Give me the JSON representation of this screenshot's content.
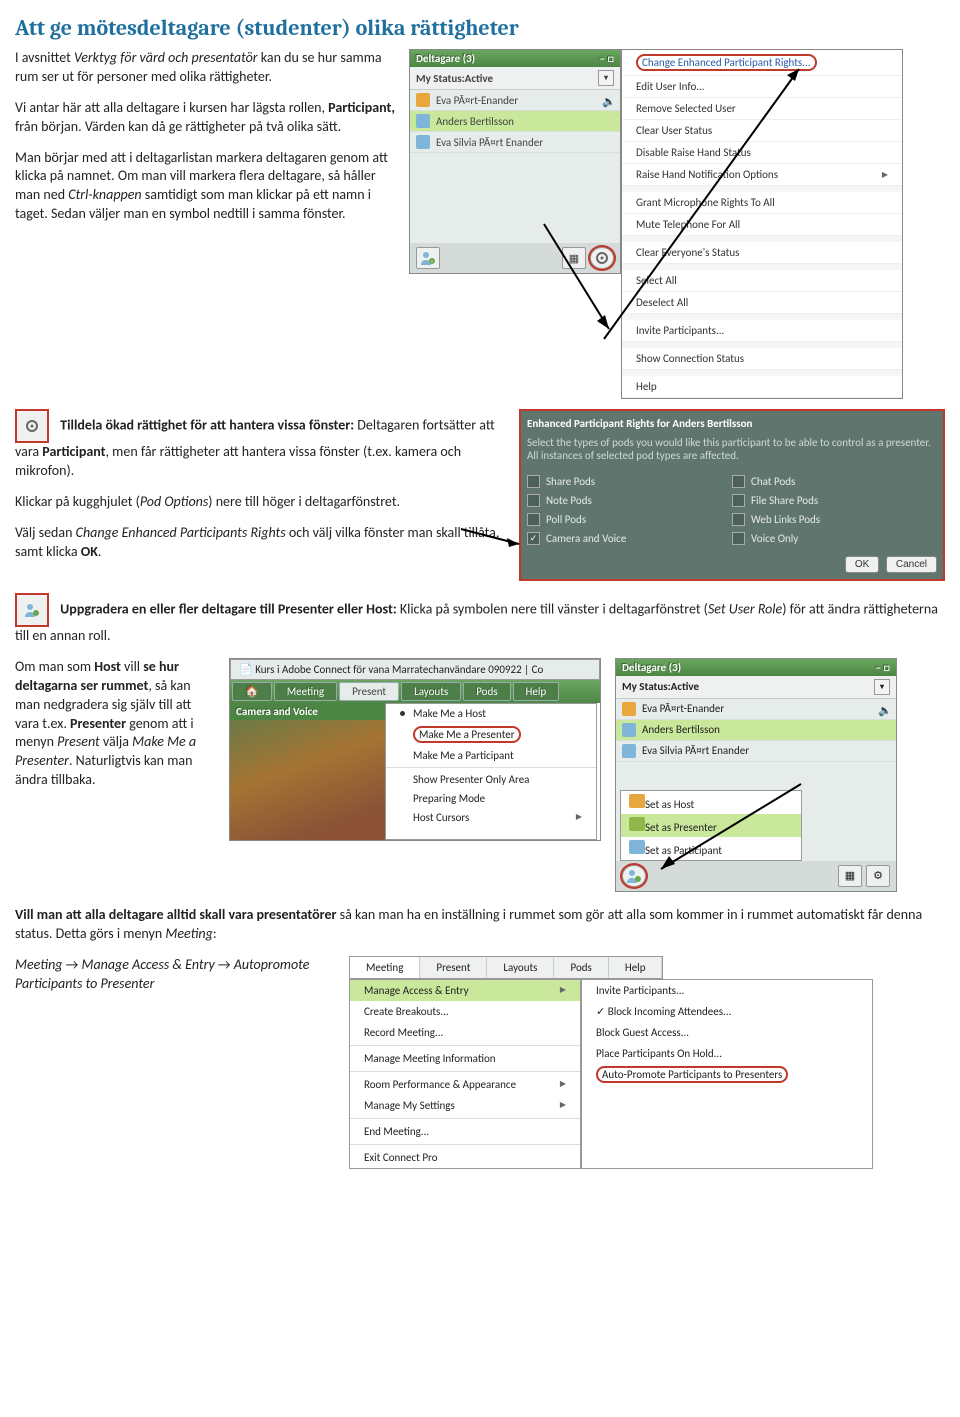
{
  "heading": "Att ge mötesdeltagare (studenter) olika rättigheter",
  "para1_a": "I avsnittet ",
  "para1_i": "Verktyg för värd och presentatör",
  "para1_b": " kan du se hur samma rum ser ut för personer med olika rättigheter.",
  "para2_a": "Vi antar här att alla deltagare i kursen har lägsta rollen, ",
  "para2_b": "Participant,",
  "para2_c": " från början. Värden kan då ge rättigheter på två olika sätt.",
  "para3_a": "Man börjar med att i deltagarlistan markera deltagaren genom att klicka på namnet. Om man vill markera flera deltagare, så håller man ned ",
  "para3_i": "Ctrl-knappen",
  "para3_b": " samtidigt som man klickar på ett namn i taget. Sedan väljer man en symbol nedtill i samma fönster.",
  "deltagare_title": "Deltagare (3)",
  "status_label": "My Status:Active",
  "p_eva": "Eva PÃ¤rt-Enander",
  "p_anders": "Anders Bertilsson",
  "p_evas": "Eva Silvia PÃ¤rt Enander",
  "ctx": {
    "change": "Change Enhanced Participant Rights...",
    "edit": "Edit User Info...",
    "remove": "Remove Selected User",
    "clear": "Clear User Status",
    "disable": "Disable Raise Hand Status",
    "raise": "Raise Hand Notification Options",
    "grantmic": "Grant Microphone Rights To All",
    "mute": "Mute Telephone For All",
    "clearall": "Clear Everyone's Status",
    "selall": "Select All",
    "desel": "Deselect All",
    "invite": "Invite Participants...",
    "conn": "Show Connection Status",
    "help": "Help"
  },
  "sec1_h": "Tilldela ökad rättighet för att hantera vissa fönster:",
  "sec1_a": " Deltagaren fortsätter att vara ",
  "sec1_b": "Participant",
  "sec1_c": ", men får rättigheter att hantera vissa fönster (t.ex. kamera och mikrofon).",
  "sec1_p2a": "Klickar på kugghjulet (",
  "sec1_p2i": "Pod Options",
  "sec1_p2b": ") nere till höger i deltagarfönstret.",
  "sec1_p3a": "Välj sedan ",
  "sec1_p3i": "Change Enhanced Participants Rights",
  "sec1_p3b": " och välj vilka fönster man skall tillåta, samt klicka ",
  "sec1_p3c": "OK",
  "sec1_p3d": ".",
  "dlg": {
    "title": "Enhanced Participant Rights for Anders Bertilsson",
    "desc": "Select the types of pods you would like this participant to be able to control as a presenter. All instances of selected pod types are affected.",
    "o1": "Share Pods",
    "o2": "Note Pods",
    "o3": "Poll Pods",
    "o4": "Camera and Voice",
    "o5": "Chat Pods",
    "o6": "File Share Pods",
    "o7": "Web Links Pods",
    "o8": "Voice Only",
    "ok": "OK",
    "cancel": "Cancel"
  },
  "sec2_h": "Uppgradera en eller fler deltagare till Presenter eller Host:",
  "sec2_a": " Klicka på symbolen nere till vänster i deltagarfönstret (",
  "sec2_i": "Set User Role",
  "sec2_b": ") för att ändra rättigheterna till en annan roll.",
  "sec2_p2a": "Om man som ",
  "sec2_p2b1": "Host",
  "sec2_p2c": " vill ",
  "sec2_p2b2": "se hur deltagarna ser rummet",
  "sec2_p2d": ", så kan man nedgradera sig själv till att vara t.ex. ",
  "sec2_p2b3": "Presenter",
  "sec2_p2e": " genom att i menyn ",
  "sec2_p2i1": "Present",
  "sec2_p2f": " välja ",
  "sec2_p2i2": "Make Me a Presenter",
  "sec2_p2g": ". Naturligtvis kan man ändra tillbaka.",
  "tabbar_title": "Kurs i Adobe Connect för vana Marratechanvändare 090922 | Co",
  "mnu": {
    "meeting": "Meeting",
    "present": "Present",
    "layouts": "Layouts",
    "pods": "Pods",
    "help": "Help"
  },
  "cam_title": "Camera and Voice",
  "presmenu": {
    "host": "Make Me a Host",
    "pres": "Make Me a Presenter",
    "part": "Make Me a Participant",
    "showp": "Show Presenter Only Area",
    "prep": "Preparing Mode",
    "cursors": "Host Cursors"
  },
  "rolemenu": {
    "host": "Set as Host",
    "pres": "Set as Presenter",
    "part": "Set as Participant"
  },
  "sec3_a1": "Vill man att alla deltagare alltid skall vara presentatörer",
  "sec3_a2": " så kan man ha en inställning i rummet som gör att alla som kommer in i rummet automatiskt får denna status. Detta görs i menyn ",
  "sec3_a2i": "Meeting",
  "sec3_a3": ":",
  "sec3_path_a": "Meeting",
  "sec3_path_b": "Manage Access & Entry",
  "sec3_path_c": "Autopromote Participants to Presenter",
  "meetmenu": {
    "manage": "Manage Access & Entry",
    "breakout": "Create Breakouts...",
    "record": "Record Meeting...",
    "info": "Manage Meeting Information",
    "perf": "Room Performance & Appearance",
    "mysettings": "Manage My Settings",
    "end": "End Meeting...",
    "exit": "Exit Connect Pro"
  },
  "meetsub": {
    "invite": "Invite Participants...",
    "block": "Block Incoming Attendees...",
    "guest": "Block Guest Access...",
    "hold": "Place Participants On Hold...",
    "auto": "Auto-Promote Participants to Presenters"
  }
}
